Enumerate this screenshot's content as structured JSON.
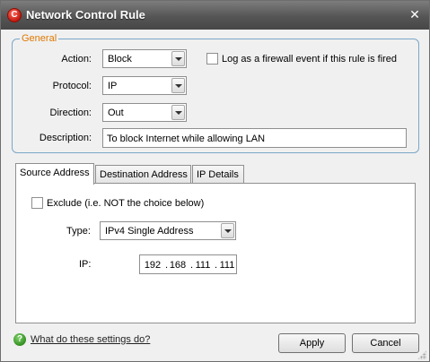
{
  "window": {
    "title": "Network Control Rule",
    "app_icon_glyph": "C",
    "close_glyph": "✕"
  },
  "general": {
    "legend": "General",
    "action_label": "Action:",
    "action_value": "Block",
    "log_label": "Log as a firewall event if this rule is fired",
    "protocol_label": "Protocol:",
    "protocol_value": "IP",
    "direction_label": "Direction:",
    "direction_value": "Out",
    "description_label": "Description:",
    "description_value": "To block Internet while allowing LAN"
  },
  "tabs": [
    {
      "label": "Source Address",
      "active": true
    },
    {
      "label": "Destination Address",
      "active": false
    },
    {
      "label": "IP Details",
      "active": false
    }
  ],
  "source": {
    "exclude_label": "Exclude (i.e. NOT the choice below)",
    "type_label": "Type:",
    "type_value": "IPv4 Single Address",
    "ip_label": "IP:",
    "ip_octets": [
      "192",
      "168",
      "111",
      "111"
    ],
    "ip_separator": "."
  },
  "footer": {
    "help_glyph": "?",
    "help_link": "What do these settings do?",
    "apply_label": "Apply",
    "cancel_label": "Cancel"
  }
}
